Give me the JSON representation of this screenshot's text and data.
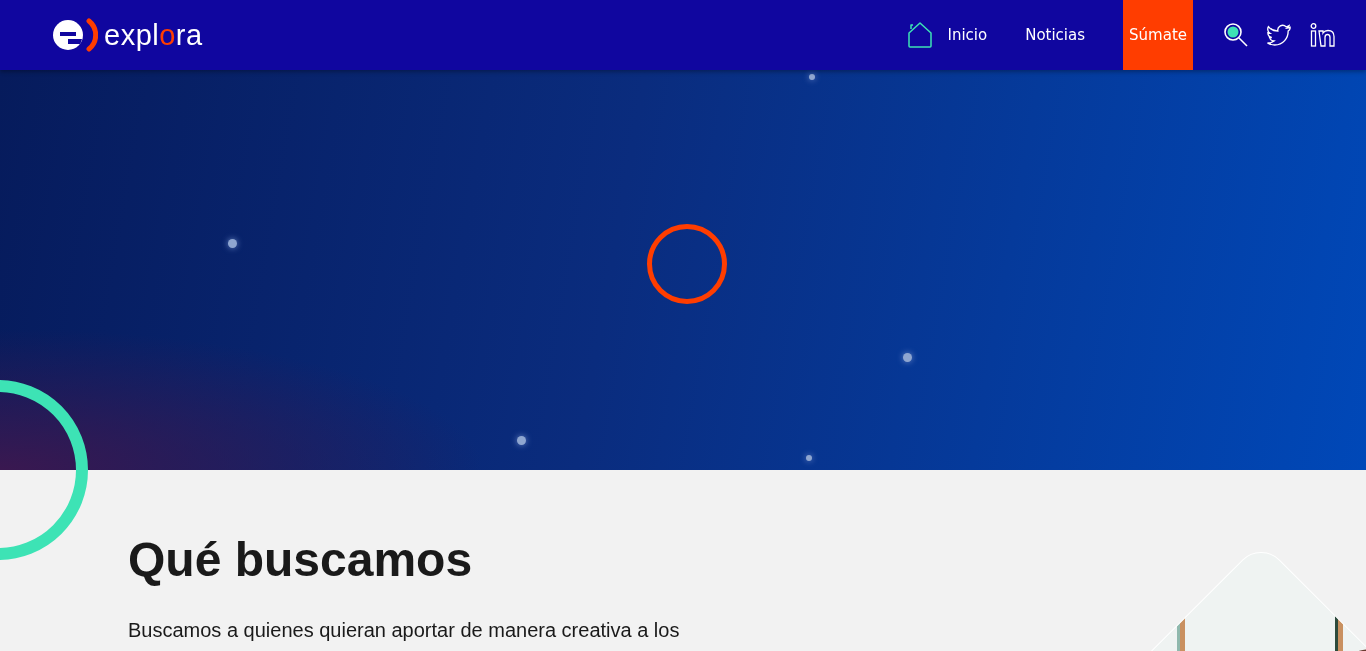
{
  "header": {
    "logo": {
      "parts": [
        {
          "text": "expl",
          "accent": false
        },
        {
          "text": "o",
          "accent": true
        },
        {
          "text": "ra",
          "accent": false
        }
      ]
    },
    "nav": [
      {
        "label": "Inicio",
        "kind": "home"
      },
      {
        "label": "Noticias",
        "kind": "link"
      },
      {
        "label": "Súmate",
        "kind": "cta"
      }
    ]
  },
  "section": {
    "title": "Qué buscamos",
    "text": "Buscamos a quienes quieran aportar de manera creativa a los"
  }
}
